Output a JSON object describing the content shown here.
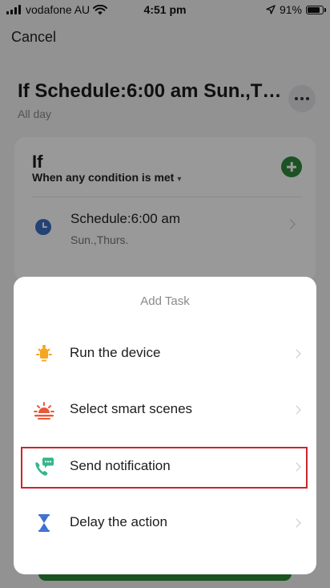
{
  "status_bar": {
    "carrier": "vodafone AU",
    "time": "4:51 pm",
    "battery": "91%",
    "battery_level": 0.91
  },
  "header": {
    "cancel_label": "Cancel",
    "title": "If Schedule:6:00 am Sun.,Thurs.",
    "subtitle": "All day"
  },
  "condition_card": {
    "if_label": "If",
    "mode": "When any condition is met",
    "conditions": [
      {
        "title": "Schedule:6:00 am",
        "subtitle": "Sun.,Thurs."
      }
    ]
  },
  "sheet": {
    "title": "Add Task",
    "options": [
      {
        "label": "Run the device",
        "icon": "bulb-icon"
      },
      {
        "label": "Select smart scenes",
        "icon": "sunrise-icon"
      },
      {
        "label": "Send notification",
        "icon": "phone-message-icon",
        "highlighted": true
      },
      {
        "label": "Delay the action",
        "icon": "hourglass-icon"
      }
    ]
  },
  "colors": {
    "accent_green": "#2e8b3a",
    "highlight_red": "#c8262d",
    "bulb_orange": "#f5a623",
    "sunrise_red": "#e9583a",
    "notification_teal": "#37b58c",
    "hourglass_blue": "#3f6fd1"
  }
}
